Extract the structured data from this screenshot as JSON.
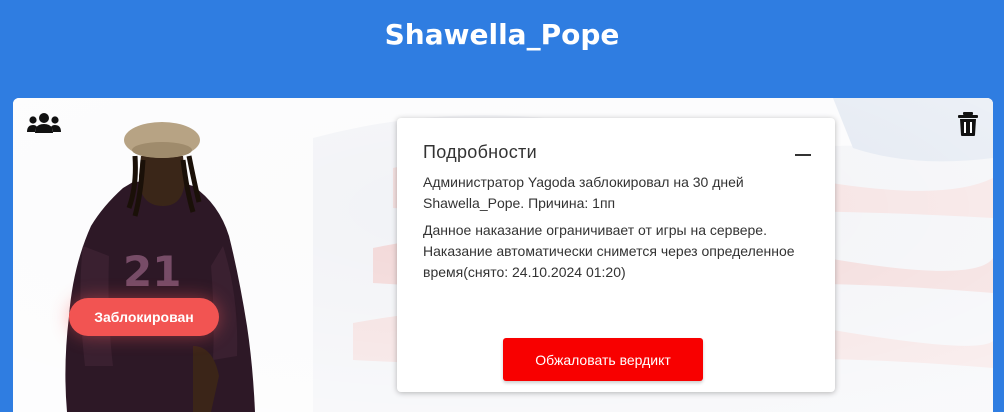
{
  "header": {
    "player_name": "Shawella_Pope"
  },
  "colors": {
    "header_bg": "#2f7de1",
    "badge_bg": "#f25452",
    "appeal_button_bg": "#f80000"
  },
  "icons": {
    "group": "users-group-icon",
    "trash": "trash-icon"
  },
  "status_badge": {
    "label": "Заблокирован"
  },
  "details": {
    "title": "Подробности",
    "collapse_icon": "minus-icon",
    "punishment_line": "Администратор Yagoda заблокировал на 30 дней Shawella_Pope. Причина: 1пп",
    "description": "Данное наказание ограничивает от игры на сервере. Наказание автоматически снимется через определенное время(снято: 24.10.2024 01:20)",
    "appeal_button_label": "Обжаловать вердикт"
  }
}
